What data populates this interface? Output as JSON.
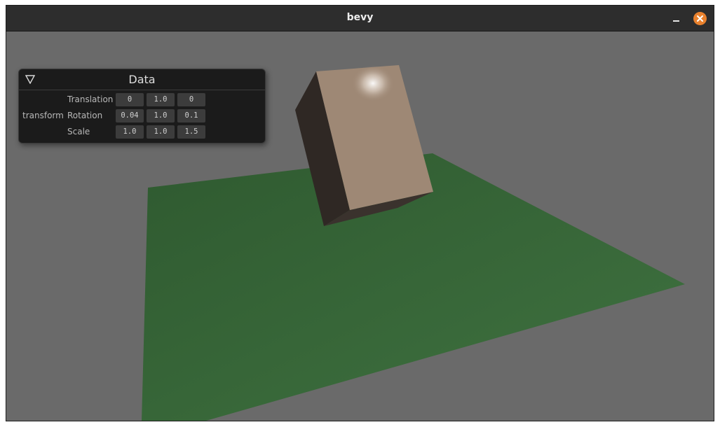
{
  "window": {
    "title": "bevy",
    "buttons": {
      "minimize_icon": "minimize-icon",
      "close_icon": "close-icon"
    },
    "close_color": "#e9812d"
  },
  "scene": {
    "background_color": "#6a6a6a",
    "ground_color": "#3e6e3c",
    "cube_face_color": "#a08a77",
    "cube_side_color": "#2e2723"
  },
  "panel": {
    "title": "Data",
    "collapse_icon": "collapse-triangle-icon",
    "group_label": "transform",
    "rows": [
      {
        "label": "Translation",
        "values": [
          "0",
          "1.0",
          "0"
        ]
      },
      {
        "label": "Rotation",
        "values": [
          "0.04",
          "1.0",
          "0.1"
        ]
      },
      {
        "label": "Scale",
        "values": [
          "1.0",
          "1.0",
          "1.5"
        ]
      }
    ]
  }
}
